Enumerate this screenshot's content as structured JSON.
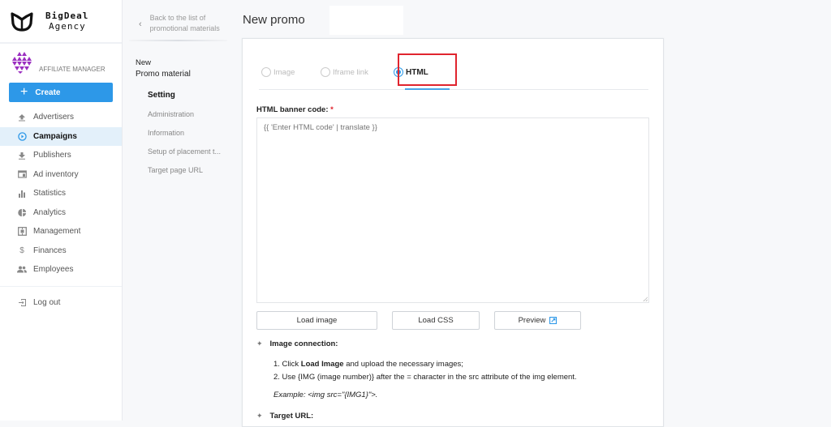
{
  "brand": {
    "name_line1": "BigDeal",
    "name_line2": "Agency"
  },
  "role": {
    "label": "AFFILIATE MANAGER"
  },
  "sidebar": {
    "create_label": "Create",
    "items": [
      {
        "label": "Advertisers",
        "icon": "upload-icon"
      },
      {
        "label": "Campaigns",
        "icon": "play-circle-icon",
        "active": true
      },
      {
        "label": "Publishers",
        "icon": "download-icon"
      },
      {
        "label": "Ad inventory",
        "icon": "inventory-icon"
      },
      {
        "label": "Statistics",
        "icon": "bar-chart-icon"
      },
      {
        "label": "Analytics",
        "icon": "pie-chart-icon"
      },
      {
        "label": "Management",
        "icon": "management-icon"
      },
      {
        "label": "Finances",
        "icon": "dollar-icon"
      },
      {
        "label": "Employees",
        "icon": "people-icon"
      }
    ],
    "logout_label": "Log out"
  },
  "subnav": {
    "back_line1": "Back to the list of",
    "back_line2": "promotional materials",
    "heading_line1": "New",
    "heading_line2": "Promo material",
    "items": [
      {
        "label": "Setting",
        "active": true
      },
      {
        "label": "Administration"
      },
      {
        "label": "Information"
      },
      {
        "label": "Setup of placement t..."
      },
      {
        "label": "Target page URL"
      }
    ]
  },
  "page": {
    "title": "New promo"
  },
  "form": {
    "tabs": [
      {
        "label": "Image",
        "selected": false
      },
      {
        "label": "Iframe link",
        "selected": false
      },
      {
        "label": "HTML",
        "selected": true
      }
    ],
    "banner_label": "HTML banner code:",
    "required_mark": "*",
    "banner_placeholder": "{{ 'Enter HTML code' | translate }}",
    "banner_value": "",
    "buttons": {
      "load_image": "Load image",
      "load_css": "Load CSS",
      "preview": "Preview"
    },
    "image_connection_title": "Image connection:",
    "steps": {
      "s1_pre": "1. Click ",
      "s1_bold": "Load Image",
      "s1_post": " and upload the necessary images;",
      "s2": "2. Use {IMG (image number)} after the = character in the src attribute of the img element."
    },
    "example": "Example: <img src=\"{IMG1}\">.",
    "target_url_title": "Target URL:"
  },
  "colors": {
    "accent": "#2d98e8",
    "highlight": "#e0242e",
    "active_bg": "#e3f0fa"
  }
}
